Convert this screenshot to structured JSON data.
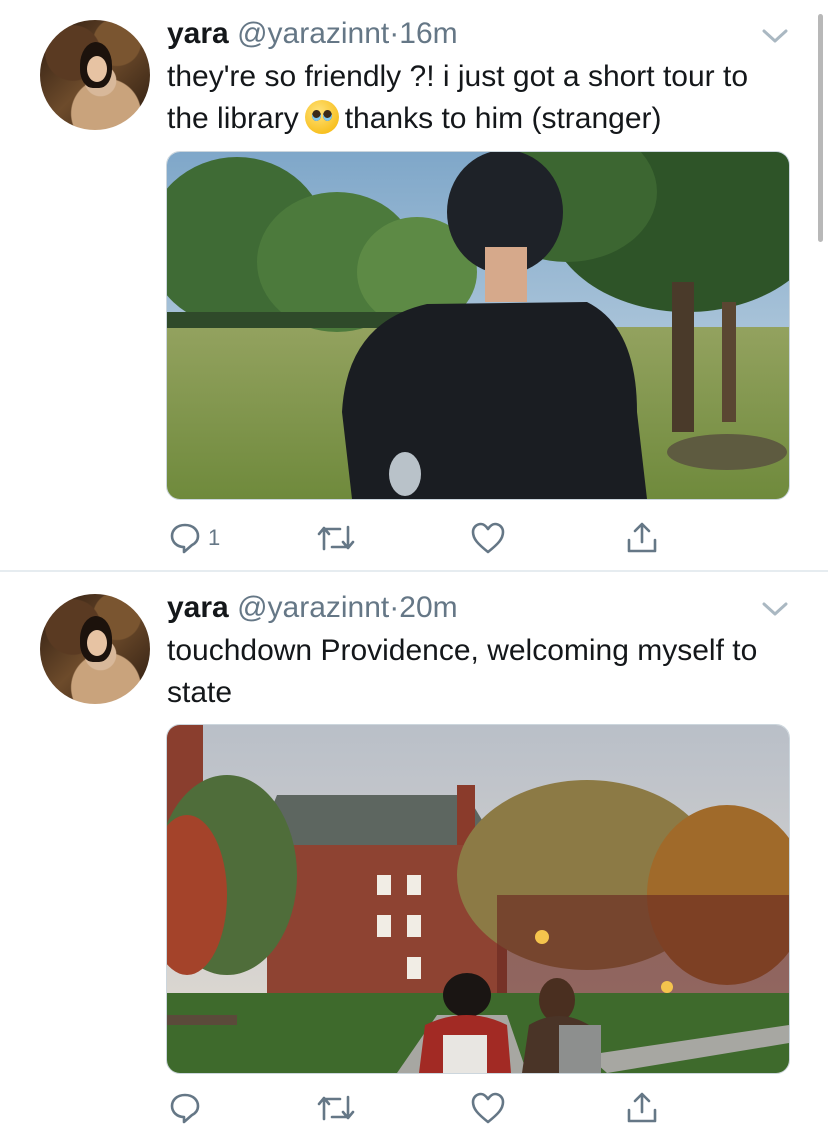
{
  "tweets": [
    {
      "name": "yara",
      "handle": "@yarazinnt",
      "separator": "·",
      "time": "16m",
      "text_before_emoji": "they're so friendly ?! i just got a short tour to the library",
      "emoji": "pleading-face",
      "text_after_emoji": "thanks to him (stranger)",
      "media_description_icon": "photo",
      "actions": {
        "reply_count": "1",
        "retweet_count": "",
        "like_count": ""
      }
    },
    {
      "name": "yara",
      "handle": "@yarazinnt",
      "separator": "·",
      "time": "20m",
      "text": "touchdown Providence, welcoming myself to state",
      "media_description_icon": "photo",
      "actions": {
        "reply_count": "",
        "retweet_count": "",
        "like_count": ""
      }
    }
  ],
  "icons": {
    "reply": "reply-icon",
    "retweet": "retweet-icon",
    "like": "heart-icon",
    "share": "share-icon",
    "more": "chevron-down-icon"
  },
  "colors": {
    "text": "#14171a",
    "secondary": "#657786",
    "divider": "#e6ecf0",
    "background": "#ffffff"
  }
}
